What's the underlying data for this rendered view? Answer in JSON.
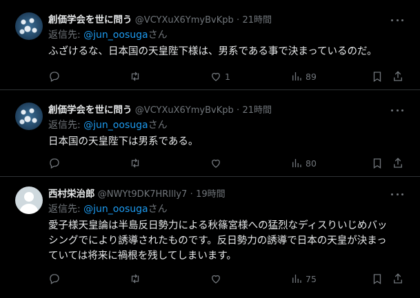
{
  "tweets": [
    {
      "name": "創価学会を世に問う",
      "handle": "@VCYXuX6YmyBvKpb",
      "dot": "·",
      "time": "21時間",
      "reply_prefix": "返信先: ",
      "reply_to": "@jun_oosuga",
      "reply_suffix": "さん",
      "text": "ふざけるな、日本国の天皇陛下様は、男系である事で決まっているのだ。",
      "likes": "1",
      "views": "89"
    },
    {
      "name": "創価学会を世に問う",
      "handle": "@VCYXuX6YmyBvKpb",
      "dot": "·",
      "time": "21時間",
      "reply_prefix": "返信先: ",
      "reply_to": "@jun_oosuga",
      "reply_suffix": "さん",
      "text": "日本国の天皇陛下は男系である。",
      "likes": "",
      "views": "80"
    },
    {
      "name": "西村栄治郎",
      "handle": "@NWYt9DK7HRIlly7",
      "dot": "·",
      "time": "19時間",
      "reply_prefix": "返信先: ",
      "reply_to": "@jun_oosuga",
      "reply_suffix": "さん",
      "text_lines": [
        "愛子様天皇論は半島反日勢力による秋篠宮様への猛烈なディスりいじめバッ",
        "シングでにより誘導されたものです。反日勢力の誘導で日本の天皇が決まっ",
        "ていては将来に禍根を残してしまいます。"
      ],
      "likes": "",
      "views": "75"
    }
  ],
  "colors": {
    "background": "#000000",
    "text": "#e7e9ea",
    "muted": "#71767b",
    "link": "#1d9bf0",
    "border": "#2f3336"
  },
  "icons": [
    "reply-icon",
    "retweet-icon",
    "like-icon",
    "views-icon",
    "bookmark-icon",
    "share-icon",
    "more-icon"
  ]
}
